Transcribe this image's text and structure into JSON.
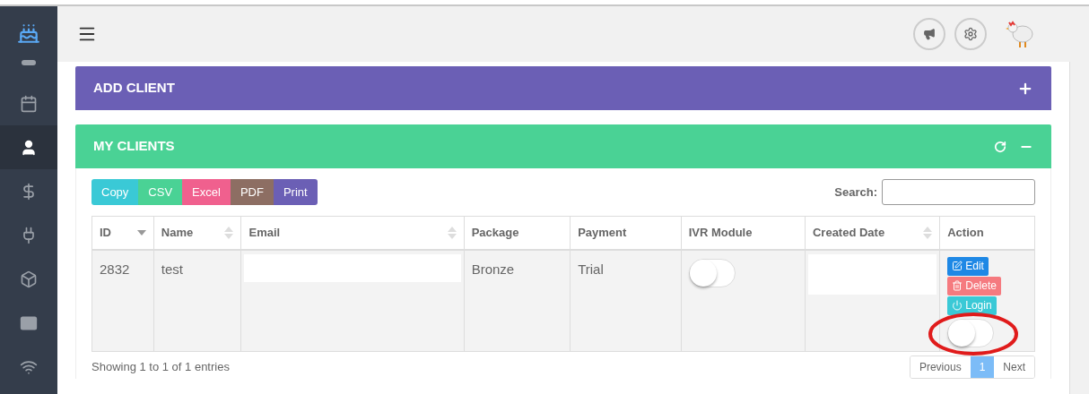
{
  "sidebar": {
    "items": [
      {
        "selected": false
      },
      {
        "selected": false
      },
      {
        "selected": true
      },
      {
        "selected": false
      },
      {
        "selected": false
      },
      {
        "selected": false
      },
      {
        "selected": false
      },
      {
        "selected": false
      }
    ]
  },
  "panels": [
    {
      "title": "ADD CLIENT",
      "expanded": false
    },
    {
      "title": "MY CLIENTS",
      "expanded": true
    }
  ],
  "export_buttons": [
    {
      "label": "Copy",
      "color": "#3ac9d6"
    },
    {
      "label": "CSV",
      "color": "#4ad295"
    },
    {
      "label": "Excel",
      "color": "#f0608e"
    },
    {
      "label": "PDF",
      "color": "#8d6e63"
    },
    {
      "label": "Print",
      "color": "#6b5fb5"
    }
  ],
  "search": {
    "label": "Search:"
  },
  "table": {
    "columns": [
      {
        "label": "ID",
        "sortable": true,
        "sorted": true
      },
      {
        "label": "Name",
        "sortable": true,
        "sorted": false
      },
      {
        "label": "Email",
        "sortable": true,
        "sorted": false
      },
      {
        "label": "Package",
        "sortable": false,
        "sorted": false
      },
      {
        "label": "Payment",
        "sortable": false,
        "sorted": false
      },
      {
        "label": "IVR Module",
        "sortable": false,
        "sorted": false
      },
      {
        "label": "Created Date",
        "sortable": true,
        "sorted": false
      },
      {
        "label": "Action",
        "sortable": false,
        "sorted": false
      }
    ],
    "rows": [
      {
        "id": "2832",
        "name": "test",
        "package": "Bronze",
        "payment": "Trial",
        "ivr_on": false,
        "actions": [
          {
            "label": "Edit",
            "kind": "edit"
          },
          {
            "label": "Delete",
            "kind": "delete"
          },
          {
            "label": "Login",
            "kind": "login"
          }
        ],
        "login_enabled": false
      }
    ]
  },
  "footer": {
    "info": "Showing 1 to 1 of 1 entries",
    "pagination": [
      {
        "label": "Previous",
        "selected": false
      },
      {
        "label": "1",
        "selected": true
      },
      {
        "label": "Next",
        "selected": false
      }
    ]
  }
}
